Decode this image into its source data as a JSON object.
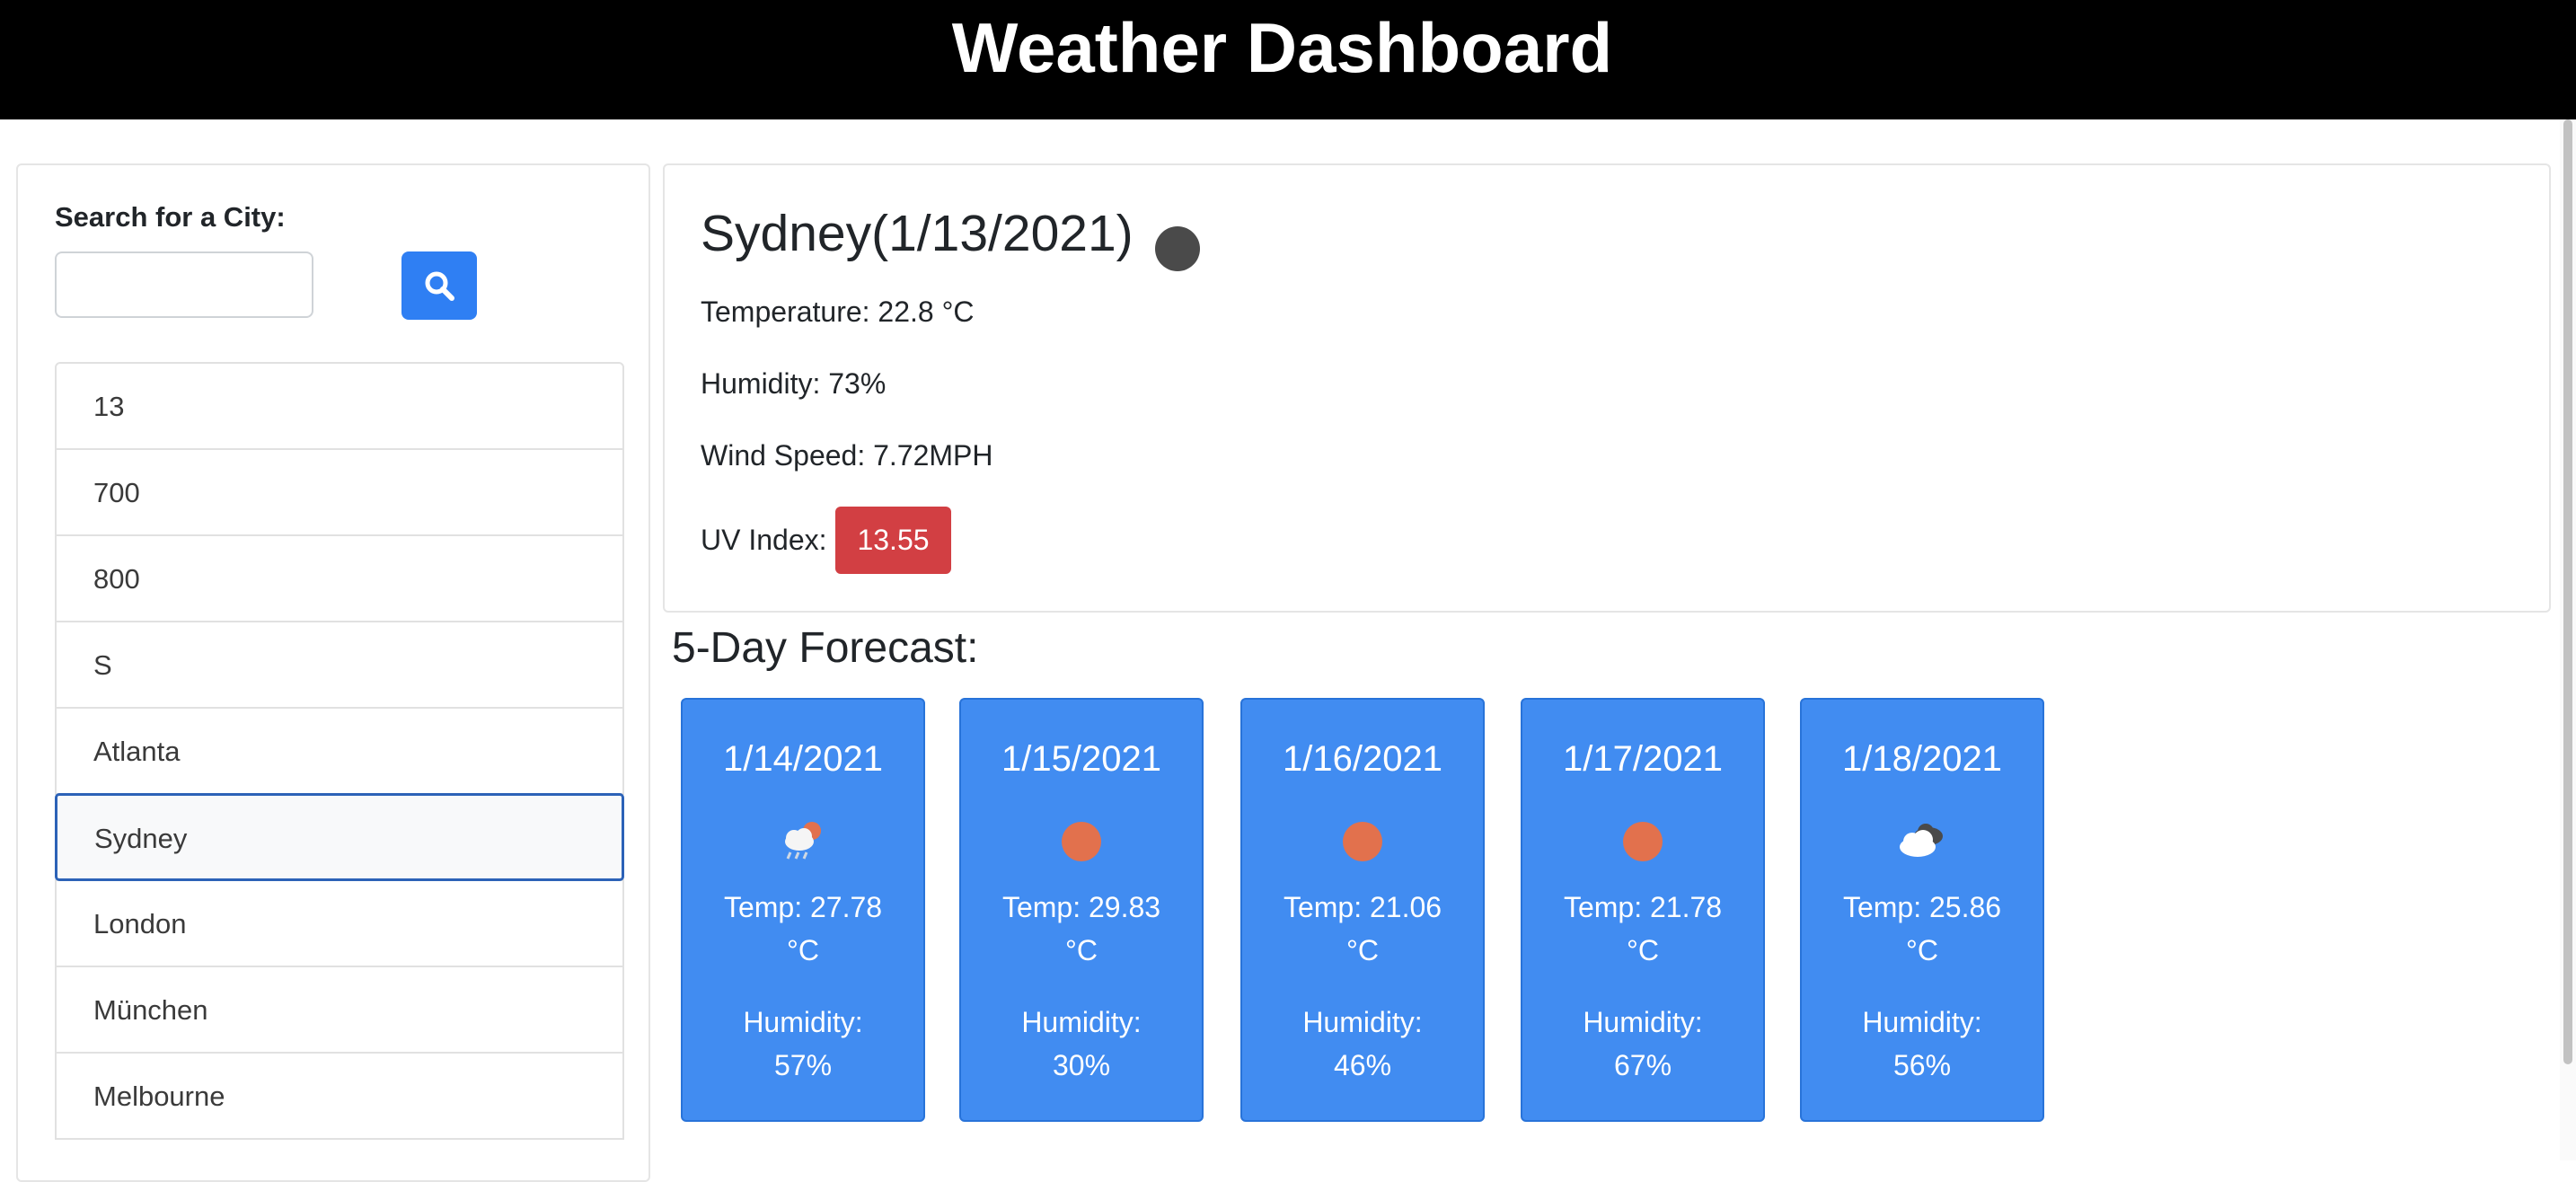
{
  "header": {
    "title": "Weather Dashboard"
  },
  "search": {
    "label": "Search for a City:",
    "input_value": "",
    "button_icon": "search-icon"
  },
  "history": {
    "items": [
      "13",
      "700",
      "800",
      "S",
      "Atlanta",
      "Sydney",
      "London",
      "München",
      "Melbourne"
    ],
    "selected": "Sydney"
  },
  "current": {
    "heading": "Sydney(1/13/2021)",
    "icon": "clear-night-icon",
    "temperature": "Temperature: 22.8 °C",
    "humidity": "Humidity: 73%",
    "wind": "Wind Speed: 7.72MPH",
    "uv_label": "UV Index:",
    "uv_value": "13.55",
    "uv_color": "#d23f43"
  },
  "forecast": {
    "heading": "5-Day Forecast:",
    "days": [
      {
        "date": "1/14/2021",
        "icon": "rain-sun-icon",
        "temp_line1": "Temp: 27.78",
        "temp_line2": "°C",
        "humidity_line1": "Humidity:",
        "humidity_line2": "57%"
      },
      {
        "date": "1/15/2021",
        "icon": "sun-icon",
        "temp_line1": "Temp: 29.83",
        "temp_line2": "°C",
        "humidity_line1": "Humidity:",
        "humidity_line2": "30%"
      },
      {
        "date": "1/16/2021",
        "icon": "sun-icon",
        "temp_line1": "Temp: 21.06",
        "temp_line2": "°C",
        "humidity_line1": "Humidity:",
        "humidity_line2": "46%"
      },
      {
        "date": "1/17/2021",
        "icon": "sun-icon",
        "temp_line1": "Temp: 21.78",
        "temp_line2": "°C",
        "humidity_line1": "Humidity:",
        "humidity_line2": "67%"
      },
      {
        "date": "1/18/2021",
        "icon": "clouds-icon",
        "temp_line1": "Temp: 25.86",
        "temp_line2": "°C",
        "humidity_line1": "Humidity:",
        "humidity_line2": "56%"
      }
    ]
  },
  "colors": {
    "accent": "#2f7ff3",
    "card": "#418cf1",
    "sun": "#e2714d",
    "header": "#000000"
  }
}
